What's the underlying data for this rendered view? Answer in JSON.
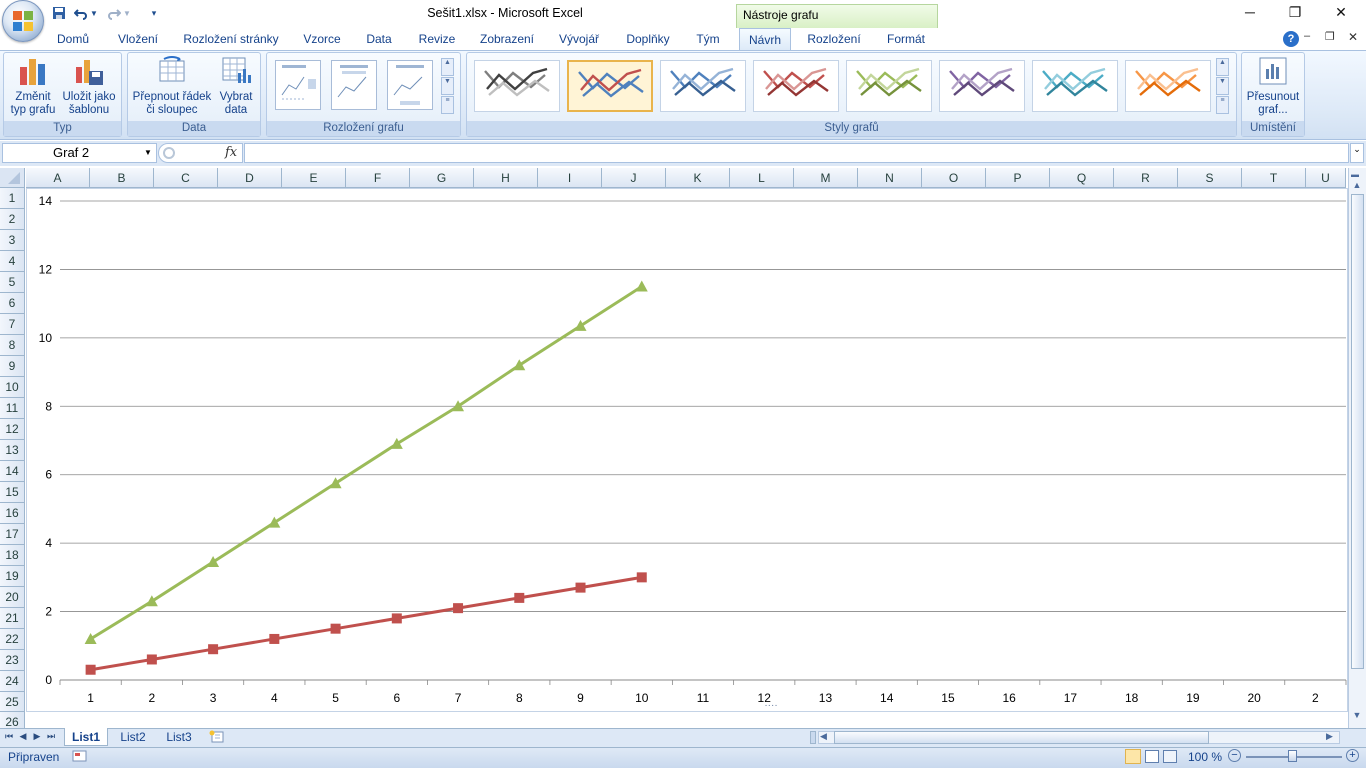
{
  "window": {
    "title": "Sešit1.xlsx - Microsoft Excel",
    "context_tab": "Nástroje grafu",
    "buttons": {
      "minimize": "─",
      "restore": "❐",
      "close": "✕"
    }
  },
  "quick_access": {
    "save_icon": "save-icon",
    "undo_icon": "undo-icon",
    "redo_icon": "redo-icon",
    "customize_icon": "customize-icon"
  },
  "tabs": [
    {
      "label": "Domů"
    },
    {
      "label": "Vložení"
    },
    {
      "label": "Rozložení stránky"
    },
    {
      "label": "Vzorce"
    },
    {
      "label": "Data"
    },
    {
      "label": "Revize"
    },
    {
      "label": "Zobrazení"
    },
    {
      "label": "Vývojář"
    },
    {
      "label": "Doplňky"
    },
    {
      "label": "Tým"
    },
    {
      "label": "Návrh"
    },
    {
      "label": "Rozložení"
    },
    {
      "label": "Formát"
    }
  ],
  "ribbon": {
    "groups": {
      "type": {
        "label": "Typ",
        "change_type": "Změnit\ntyp grafu",
        "save_template": "Uložit jako\nšablonu"
      },
      "data": {
        "label": "Data",
        "switch": "Přepnout řádek\nči sloupec",
        "select": "Vybrat\ndata"
      },
      "layout": {
        "label": "Rozložení grafu"
      },
      "styles": {
        "label": "Styly grafů",
        "items": [
          {
            "c1": "#7f7f7f",
            "c2": "#404040",
            "c3": "#bfbfbf"
          },
          {
            "c1": "#4f81bd",
            "c2": "#c0504d",
            "c3": "#4f81bd"
          },
          {
            "c1": "#4f81bd",
            "c2": "#95b3d7",
            "c3": "#376092"
          },
          {
            "c1": "#c0504d",
            "c2": "#d99694",
            "c3": "#943634"
          },
          {
            "c1": "#9bbb59",
            "c2": "#c3d69b",
            "c3": "#76923c"
          },
          {
            "c1": "#8064a2",
            "c2": "#b3a2c7",
            "c3": "#5f497a"
          },
          {
            "c1": "#4bacc6",
            "c2": "#93cddd",
            "c3": "#31859c"
          },
          {
            "c1": "#f79646",
            "c2": "#fac090",
            "c3": "#e46c0a"
          }
        ]
      },
      "location": {
        "label": "Umístění",
        "move": "Přesunout\ngraf..."
      }
    }
  },
  "formula_bar": {
    "name_box": "Graf 2",
    "fx": "fx",
    "value": ""
  },
  "columns": [
    "A",
    "B",
    "C",
    "D",
    "E",
    "F",
    "G",
    "H",
    "I",
    "J",
    "K",
    "L",
    "M",
    "N",
    "O",
    "P",
    "Q",
    "R",
    "S",
    "T",
    "U"
  ],
  "rows": [
    "1",
    "2",
    "3",
    "4",
    "5",
    "6",
    "7",
    "8",
    "9",
    "10",
    "11",
    "12",
    "13",
    "14",
    "15",
    "16",
    "17",
    "18",
    "19",
    "20",
    "21",
    "22",
    "23",
    "24",
    "25",
    "26"
  ],
  "chart_data": {
    "type": "line",
    "x": [
      1,
      2,
      3,
      4,
      5,
      6,
      7,
      8,
      9,
      10
    ],
    "x_ticks": [
      "1",
      "2",
      "3",
      "4",
      "5",
      "6",
      "7",
      "8",
      "9",
      "10",
      "11",
      "12",
      "13",
      "14",
      "15",
      "16",
      "17",
      "18",
      "19",
      "20",
      "2"
    ],
    "ylim": [
      0,
      14
    ],
    "y_ticks": [
      "0",
      "2",
      "4",
      "6",
      "8",
      "10",
      "12",
      "14"
    ],
    "grid": true,
    "series": [
      {
        "color": "#c0504d",
        "marker": "square",
        "values": [
          0.3,
          0.6,
          0.9,
          1.2,
          1.5,
          1.8,
          2.1,
          2.4,
          2.7,
          3.0
        ]
      },
      {
        "color": "#9bbb59",
        "marker": "triangle",
        "values": [
          1.2,
          2.3,
          3.45,
          4.6,
          5.75,
          6.9,
          8.0,
          9.2,
          10.35,
          11.5
        ]
      }
    ]
  },
  "sheets": [
    {
      "label": "List1",
      "active": true
    },
    {
      "label": "List2",
      "active": false
    },
    {
      "label": "List3",
      "active": false
    }
  ],
  "status": {
    "text": "Připraven",
    "zoom": "100 %"
  }
}
